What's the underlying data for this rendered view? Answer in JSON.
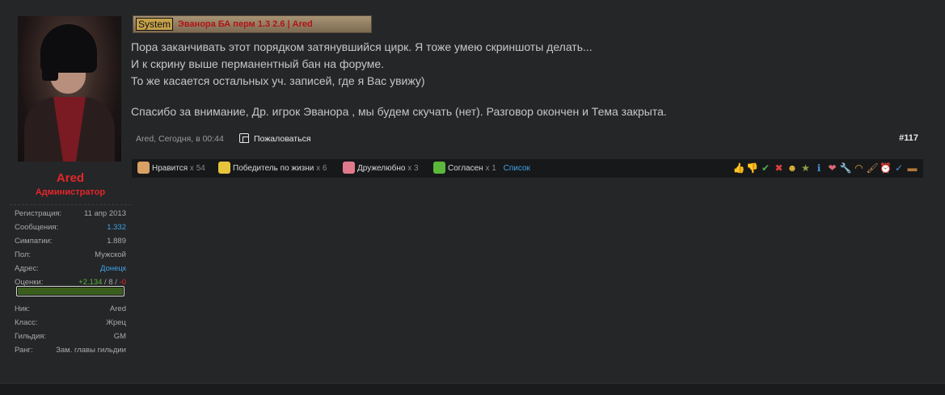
{
  "user": {
    "name": "Ared",
    "title": "Администратор",
    "stats": [
      {
        "key": "Регистрация:",
        "value": "11 апр 2013",
        "link": false
      },
      {
        "key": "Сообщения:",
        "value": "1.332",
        "link": true
      },
      {
        "key": "Симпатии:",
        "value": "1.889",
        "link": false
      },
      {
        "key": "Пол:",
        "value": "Мужской",
        "link": false
      },
      {
        "key": "Адрес:",
        "value": "Донецк",
        "link": true
      }
    ],
    "ratings": {
      "key": "Оценки:",
      "positive": "+2.134",
      "sep1": " / ",
      "neutral": "8",
      "sep2": " / ",
      "negative": "-0"
    },
    "rep_fill": 1.0,
    "char": [
      {
        "key": "Ник:",
        "value": "Ared"
      },
      {
        "key": "Класс:",
        "value": "Жрец"
      },
      {
        "key": "Гильдия:",
        "value": "GM"
      },
      {
        "key": "Ранг:",
        "value": "Зам. главы гильдии"
      }
    ]
  },
  "post": {
    "prefix": "System",
    "title": "Эванора БА перм 1.3 2.6 | Ared",
    "lines": [
      "Пора заканчивать этот порядком затянувшийся цирк. Я тоже умею скриншоты делать...",
      "И к скрину выше перманентный бан на форуме.",
      "То же касается остальных уч. записей, где я Вас увижу)",
      "",
      "Спасибо за внимание, Др. игрок Эванора , мы будем скучать (нет). Разговор окончен и Тема закрыта."
    ],
    "meta": "Ared, Сегодня, в 00:44",
    "report_label": "Пожаловаться",
    "number": "#117"
  },
  "likes": [
    {
      "label": "Нравится",
      "x": "x 54",
      "icon": "thumbs-up-icon",
      "color": "#d9a066"
    },
    {
      "label": "Победитель по жизни",
      "x": "x 6",
      "icon": "star-icon",
      "color": "#e7c43b"
    },
    {
      "label": "Дружелюбно",
      "x": "x 3",
      "icon": "heart-icon",
      "color": "#e07a8a"
    },
    {
      "label": "Согласен",
      "x": "x 1",
      "icon": "checkmark-icon",
      "color": "#5cb83a"
    }
  ],
  "likes_list_label": "Список",
  "rating_icons": [
    {
      "name": "thumbs-up-icon",
      "glyph": "👍",
      "color": "#c8956a"
    },
    {
      "name": "thumbs-down-icon",
      "glyph": "👎",
      "color": "#c8956a"
    },
    {
      "name": "checkmark-icon",
      "glyph": "✔",
      "color": "#4caf50"
    },
    {
      "name": "cross-icon",
      "glyph": "✖",
      "color": "#e04040"
    },
    {
      "name": "smiley-icon",
      "glyph": "☻",
      "color": "#e8b83a"
    },
    {
      "name": "medal-icon",
      "glyph": "★",
      "color": "#8aa34a"
    },
    {
      "name": "info-icon",
      "glyph": "ℹ",
      "color": "#4a8fd8"
    },
    {
      "name": "heart-icon",
      "glyph": "❤",
      "color": "#d86878"
    },
    {
      "name": "wrench-icon",
      "glyph": "🔧",
      "color": "#c8a070"
    },
    {
      "name": "rainbow-icon",
      "glyph": "◠",
      "color": "#e0a040"
    },
    {
      "name": "brush-icon",
      "glyph": "🖌",
      "color": "#c89060"
    },
    {
      "name": "alarm-clock-icon",
      "glyph": "⏰",
      "color": "#e05040"
    },
    {
      "name": "check-mark-blue-icon",
      "glyph": "✓",
      "color": "#4a90e2"
    },
    {
      "name": "chest-icon",
      "glyph": "▬",
      "color": "#b07a3a"
    }
  ]
}
